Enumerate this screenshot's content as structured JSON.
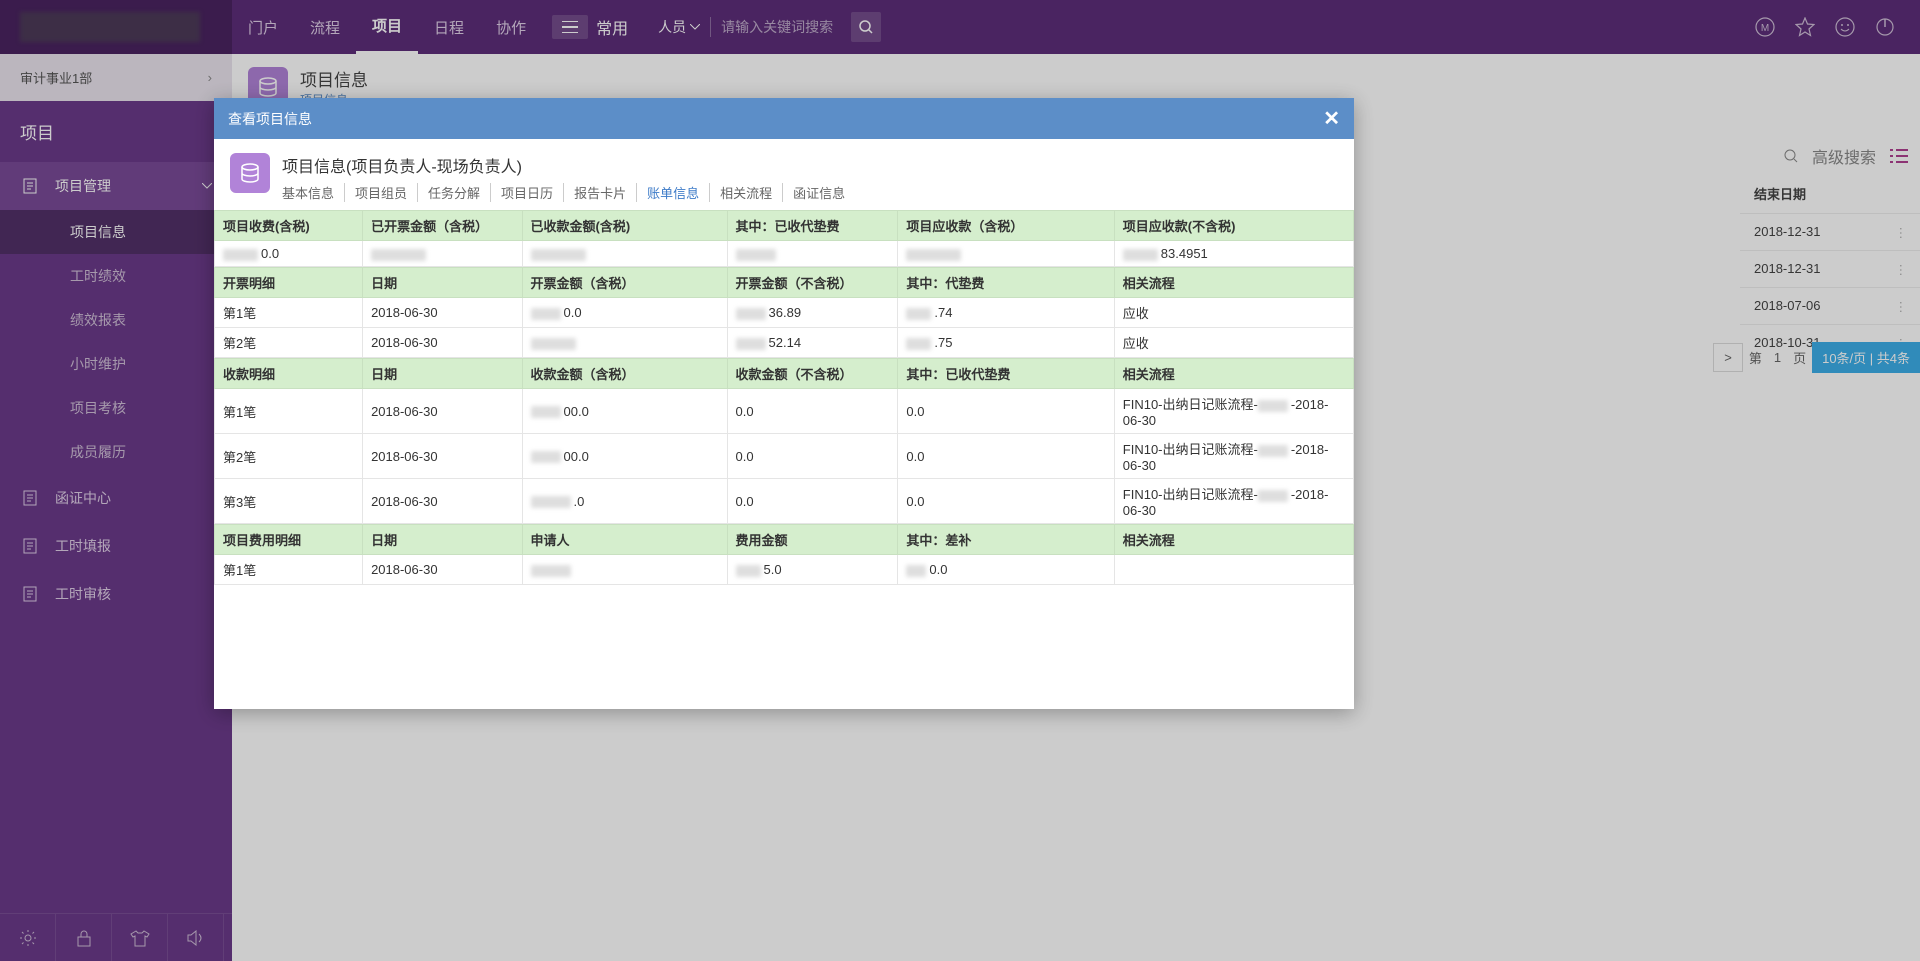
{
  "topnav": {
    "items": [
      "门户",
      "流程",
      "项目",
      "日程",
      "协作"
    ],
    "active_index": 2,
    "common_label": "常用",
    "search_type": "人员",
    "search_placeholder": "请输入关键词搜索"
  },
  "sidebar": {
    "dept": "审计事业1部",
    "title": "项目",
    "groups": [
      {
        "label": "项目管理",
        "icon": "doc",
        "expanded": true,
        "subs": [
          "项目信息",
          "工时绩效",
          "绩效报表",
          "小时维护",
          "项目考核",
          "成员履历"
        ],
        "active_sub": 0
      },
      {
        "label": "函证中心",
        "icon": "doc"
      },
      {
        "label": "工时填报",
        "icon": "doc"
      },
      {
        "label": "工时审核",
        "icon": "doc"
      }
    ]
  },
  "content": {
    "header_title": "项目信息",
    "header_sub": "项目信息",
    "toolbar_search": "高级搜索",
    "date_header": "结束日期",
    "dates": [
      "2018-12-31",
      "2018-12-31",
      "2018-07-06",
      "2018-10-31"
    ],
    "pagination": {
      "prev": ">",
      "label_pre": "第",
      "page": "1",
      "label_post": "页",
      "info": "10条/页 | 共4条"
    }
  },
  "modal": {
    "header": "查看项目信息",
    "title": "项目信息(项目负责人-现场负责人)",
    "tabs": [
      "基本信息",
      "项目组员",
      "任务分解",
      "项目日历",
      "报告卡片",
      "账单信息",
      "相关流程",
      "函证信息"
    ],
    "active_tab": 5,
    "summary": {
      "headers": [
        "项目收费(含税)",
        "已开票金额（含税）",
        "已收款金额(含税)",
        "其中：已收代垫费",
        "项目应收款（含税）",
        "项目应收款(不含税)"
      ],
      "values": [
        "0.0",
        "",
        "",
        "",
        "",
        "83.4951"
      ]
    },
    "invoice": {
      "headers": [
        "开票明细",
        "日期",
        "开票金额（含税）",
        "开票金额（不含税）",
        "其中：代垫费",
        "相关流程"
      ],
      "rows": [
        {
          "col0": "第1笔",
          "col1": "2018-06-30",
          "col2": "0.0",
          "col3": "36.89",
          "col4": ".74",
          "col5": "应收"
        },
        {
          "col0": "第2笔",
          "col1": "2018-06-30",
          "col2": "",
          "col3": "52.14",
          "col4": ".75",
          "col5": "应收"
        }
      ]
    },
    "receipt": {
      "headers": [
        "收款明细",
        "日期",
        "收款金额（含税）",
        "收款金额（不含税）",
        "其中：已收代垫费",
        "相关流程"
      ],
      "rows": [
        {
          "col0": "第1笔",
          "col1": "2018-06-30",
          "col2": "00.0",
          "col3": "0.0",
          "col4": "0.0",
          "col5a": "FIN10-出纳日记账流程-",
          "col5b": "-2018-06-30"
        },
        {
          "col0": "第2笔",
          "col1": "2018-06-30",
          "col2": "00.0",
          "col3": "0.0",
          "col4": "0.0",
          "col5a": "FIN10-出纳日记账流程-",
          "col5b": "-2018-06-30"
        },
        {
          "col0": "第3笔",
          "col1": "2018-06-30",
          "col2": ".0",
          "col3": "0.0",
          "col4": "0.0",
          "col5a": "FIN10-出纳日记账流程-",
          "col5b": "-2018-06-30"
        }
      ]
    },
    "expense": {
      "headers": [
        "项目费用明细",
        "日期",
        "申请人",
        "费用金额",
        "其中：差补",
        "相关流程"
      ],
      "rows": [
        {
          "col0": "第1笔",
          "col1": "2018-06-30",
          "col2": "",
          "col3": "5.0",
          "col4": "0.0",
          "col5": ""
        }
      ]
    }
  }
}
